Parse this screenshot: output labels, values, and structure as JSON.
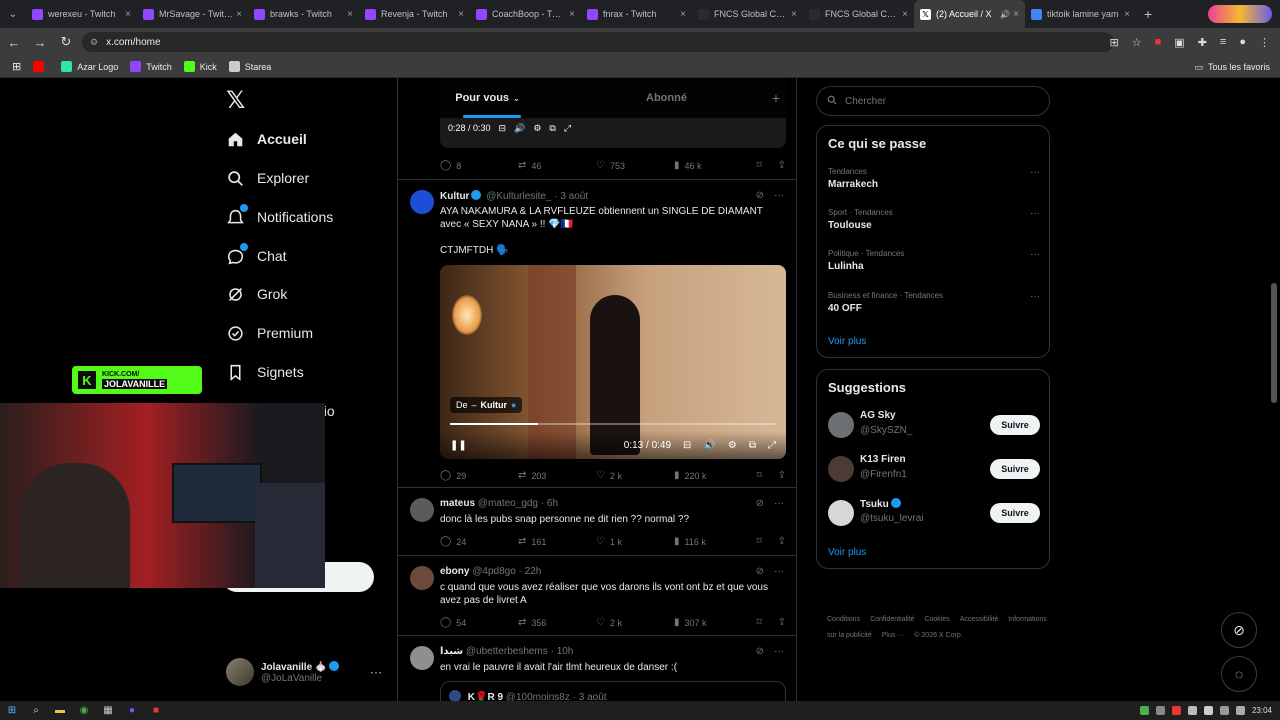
{
  "browser": {
    "tabs": [
      {
        "label": "werexeu - Twitch",
        "color": "#9146ff"
      },
      {
        "label": "MrSavage - Twitch",
        "color": "#9146ff"
      },
      {
        "label": "brawks - Twitch",
        "color": "#9146ff"
      },
      {
        "label": "Revenja - Twitch",
        "color": "#9146ff"
      },
      {
        "label": "CoachBoop - Twitch",
        "color": "#9146ff"
      },
      {
        "label": "fnrax - Twitch",
        "color": "#9146ff"
      },
      {
        "label": "FNCS Global Cham",
        "color": "#2b2b2b"
      },
      {
        "label": "FNCS Global Cham",
        "color": "#2b2b2b"
      },
      {
        "label": "(2) Accueil / X",
        "color": "#ffffff"
      },
      {
        "label": "tiktoik lamine yam",
        "color": "#4285f4"
      }
    ],
    "url": "x.com/home",
    "bookmarks": [
      {
        "label": "",
        "color": "#ff0000"
      },
      {
        "label": "Azar Logo",
        "color": "#2ee59d"
      },
      {
        "label": "Twitch",
        "color": "#9146ff"
      },
      {
        "label": "Kick",
        "color": "#53fc18"
      },
      {
        "label": "Starea",
        "color": "#cccccc"
      }
    ],
    "all_bookmarks": "Tous les favoris"
  },
  "nav": {
    "items": [
      {
        "label": "Accueil",
        "icon": "home-icon"
      },
      {
        "label": "Explorer",
        "icon": "search-icon"
      },
      {
        "label": "Notifications",
        "icon": "bell-icon"
      },
      {
        "label": "Chat",
        "icon": "chat-icon"
      },
      {
        "label": "Grok",
        "icon": "grok-icon"
      },
      {
        "label": "Premium",
        "icon": "premium-icon"
      },
      {
        "label": "Signets",
        "icon": "bookmark-icon"
      }
    ],
    "partial_label": "dio",
    "profile": {
      "name": "Jolavanille",
      "handle": "@JoLaVanille"
    }
  },
  "overlay": {
    "kick_line1": "KICK.COM/",
    "kick_line2": "JOLAVANILLE"
  },
  "feed": {
    "tabs": [
      "Pour vous",
      "Abonné"
    ],
    "top_video": {
      "time": "0:28 / 0:30"
    },
    "top_actions": {
      "replies": "8",
      "reposts": "46",
      "likes": "753",
      "views": "46 k"
    },
    "tweets": [
      {
        "name": "Kultur",
        "handle": "@Kulturlesite_",
        "time": "3 août",
        "text1": "AYA NAKAMURA & LA RVFLEUZE obtiennent un SINGLE DE DIAMANT avec « SEXY NANA » !! 💎🇫🇷",
        "text2": "CTJMFTDH 🗣️",
        "video_from": "De",
        "video_from_name": "Kultur",
        "video_time": "0:13 / 0:49",
        "video_progress": 0.27,
        "replies": "29",
        "reposts": "203",
        "likes": "2 k",
        "views": "220 k"
      },
      {
        "name": "mateus",
        "handle": "@mateo_gdg",
        "time": "6h",
        "text": "donc là les pubs snap personne ne dit rien ?? normal ??",
        "replies": "24",
        "reposts": "161",
        "likes": "1 k",
        "views": "116 k"
      },
      {
        "name": "ebony",
        "handle": "@4pd8go",
        "time": "22h",
        "text": "c quand que vous avez réaliser que vos darons ils vont ont bz et que vous avez pas de livret A",
        "replies": "54",
        "reposts": "356",
        "likes": "2 k",
        "views": "307 k"
      },
      {
        "name": "شبدا",
        "handle": "@ubetterbeshems",
        "time": "10h",
        "text": "en vrai le pauvre il avait l'air tlmt heureux de danser :(",
        "quote_name": "K🌹R 9",
        "quote_handle": "@100moins8z",
        "quote_time": "3 août"
      }
    ]
  },
  "sidebar": {
    "search_placeholder": "Chercher",
    "trends_title": "Ce qui se passe",
    "trends": [
      {
        "category": "Tendances",
        "name": "Marrakech"
      },
      {
        "category": "Sport · Tendances",
        "name": "Toulouse"
      },
      {
        "category": "Politique · Tendances",
        "name": "Lulinha"
      },
      {
        "category": "Business et finance · Tendances",
        "name": "40 OFF"
      }
    ],
    "see_more": "Voir plus",
    "suggestions_title": "Suggestions",
    "suggestions": [
      {
        "name": "AG Sky",
        "handle": "@SkySZN_",
        "verified": false
      },
      {
        "name": "K13 Firen",
        "handle": "@Firenfn1",
        "verified": false
      },
      {
        "name": "Tsuku",
        "handle": "@tsuku_levrai",
        "verified": true
      }
    ],
    "follow_label": "Suivre",
    "footer": [
      "Conditions",
      "Confidentialité",
      "Cookies",
      "Accessibilité",
      "Informations sur la publicité",
      "Plus ···",
      "© 2026 X Corp."
    ]
  },
  "taskbar": {
    "clock": "23:04"
  }
}
